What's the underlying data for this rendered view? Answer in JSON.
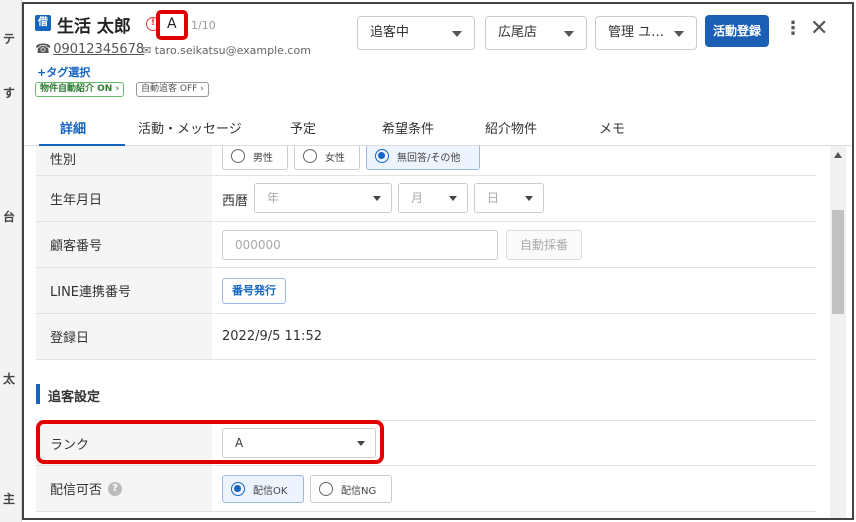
{
  "background": {
    "fragments": [
      "テ",
      "す",
      "台",
      "太",
      "主"
    ]
  },
  "header": {
    "badge": "借",
    "name": "生活 太郎",
    "rank_warning": "!",
    "rank": "A",
    "rank_count": "1/10",
    "phone": "09012345678",
    "email": "taro.seikatsu@example.com",
    "tag_select": "+タグ選択",
    "auto_intro": "物件自動紹介 ON",
    "auto_follow": "自動追客 OFF",
    "status_select": "追客中",
    "store_select": "広尾店",
    "manager_select": "管理 ユ…",
    "activity_button": "活動登録",
    "more_icon": "⋮",
    "close_icon": "✕"
  },
  "tabs": [
    {
      "label": "詳細"
    },
    {
      "label": "活動・メッセージ"
    },
    {
      "label": "予定"
    },
    {
      "label": "希望条件"
    },
    {
      "label": "紹介物件"
    },
    {
      "label": "メモ"
    }
  ],
  "form": {
    "gender": {
      "label": "性別",
      "options": [
        "男性",
        "女性",
        "無回答/その他"
      ],
      "selected": "無回答/その他"
    },
    "birthdate": {
      "label": "生年月日",
      "era": "西暦",
      "year_placeholder": "年",
      "month_placeholder": "月",
      "day_placeholder": "日"
    },
    "customer_number": {
      "label": "顧客番号",
      "placeholder": "000000",
      "auto_button": "自動採番"
    },
    "line_number": {
      "label": "LINE連携番号",
      "issue_button": "番号発行"
    },
    "registered": {
      "label": "登録日",
      "value": "2022/9/5 11:52"
    }
  },
  "follow_section": {
    "title": "追客設定",
    "rank": {
      "label": "ランク",
      "value": "A"
    },
    "delivery": {
      "label": "配信可否",
      "help": "?",
      "options": [
        "配信OK",
        "配信NG"
      ],
      "selected": "配信OK"
    }
  },
  "colors": {
    "accent": "#1565c0",
    "highlight": "#e00000"
  }
}
